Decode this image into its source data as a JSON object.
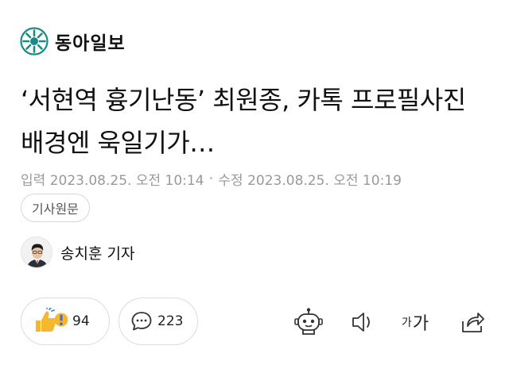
{
  "brand": {
    "name": "동아일보"
  },
  "article": {
    "title": "‘서현역 흉기난동’ 최원종, 카톡 프로필사진 배경엔 욱일기가…",
    "published": "입력 2023.08.25. 오전 10:14",
    "modified": "수정 2023.08.25. 오전 10:19",
    "date_separator": "•",
    "source_button": "기사원문",
    "reporter": "송치훈 기자"
  },
  "actions": {
    "reaction_count": "94",
    "comment_count": "223",
    "font_small": "가",
    "font_large": "가"
  },
  "colors": {
    "brand_teal": "#1a8a86",
    "meta_text": "#999999",
    "reaction_yellow": "#f5b72e",
    "reaction_blue": "#3d6fe0"
  }
}
